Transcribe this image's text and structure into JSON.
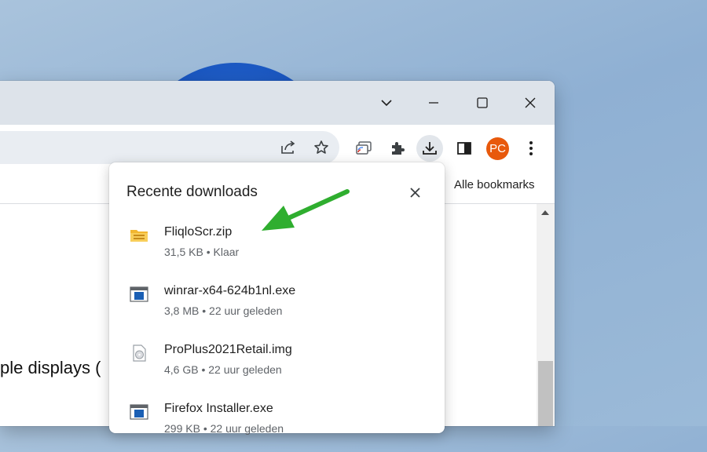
{
  "browser": {
    "avatar_initials": "PC",
    "bookmarks_label": "Alle bookmarks",
    "accent_color": "#e8590c"
  },
  "page": {
    "visible_text": "ple displays ("
  },
  "downloads_panel": {
    "title": "Recente downloads",
    "items": [
      {
        "name": "FliqloScr.zip",
        "status": "31,5  KB • Klaar",
        "icon": "zip-folder-icon"
      },
      {
        "name": "winrar-x64-624b1nl.exe",
        "status": "3,8 MB • 22 uur geleden",
        "icon": "exe-window-icon"
      },
      {
        "name": "ProPlus2021Retail.img",
        "status": "4,6 GB • 22 uur geleden",
        "icon": "disc-image-icon"
      },
      {
        "name": "Firefox Installer.exe",
        "status": "299 KB • 22 uur geleden",
        "icon": "exe-window-icon"
      }
    ]
  },
  "annotation": {
    "arrow_color": "#2fae2f"
  }
}
